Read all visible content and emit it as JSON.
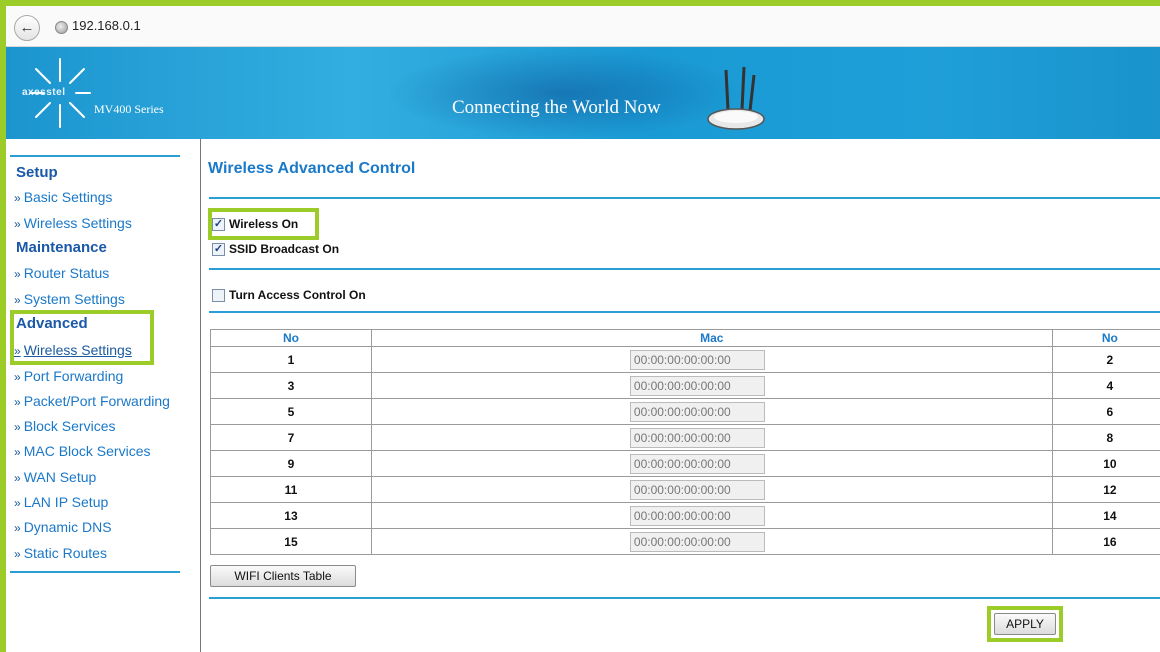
{
  "browser": {
    "back_icon": "back-arrow-icon",
    "url": "192.168.0.1"
  },
  "banner": {
    "brand": "axesstel",
    "series": "MV400 Series",
    "tagline": "Connecting the World Now"
  },
  "sidebar": {
    "sections": [
      {
        "heading": "Setup",
        "items": [
          "Basic Settings",
          "Wireless Settings"
        ]
      },
      {
        "heading": "Maintenance",
        "items": [
          "Router Status",
          "System Settings"
        ]
      },
      {
        "heading": "Advanced",
        "items": [
          "Wireless Settings",
          "Port Forwarding",
          "Packet/Port Forwarding",
          "Block Services",
          "MAC Block Services",
          "WAN Setup",
          "LAN IP Setup",
          "Dynamic DNS",
          "Static Routes"
        ]
      }
    ],
    "arrow": "»"
  },
  "main": {
    "title": "Wireless Advanced Control",
    "wireless_on": {
      "label": "Wireless On",
      "checked": true
    },
    "ssid_broadcast": {
      "label": "SSID Broadcast On",
      "checked": true
    },
    "access_control": {
      "label": "Turn Access Control On",
      "checked": false
    },
    "table": {
      "headers": [
        "No",
        "Mac",
        "No"
      ],
      "rows": [
        {
          "no_left": "1",
          "mac": "00:00:00:00:00:00",
          "no_right": "2"
        },
        {
          "no_left": "3",
          "mac": "00:00:00:00:00:00",
          "no_right": "4"
        },
        {
          "no_left": "5",
          "mac": "00:00:00:00:00:00",
          "no_right": "6"
        },
        {
          "no_left": "7",
          "mac": "00:00:00:00:00:00",
          "no_right": "8"
        },
        {
          "no_left": "9",
          "mac": "00:00:00:00:00:00",
          "no_right": "10"
        },
        {
          "no_left": "11",
          "mac": "00:00:00:00:00:00",
          "no_right": "12"
        },
        {
          "no_left": "13",
          "mac": "00:00:00:00:00:00",
          "no_right": "14"
        },
        {
          "no_left": "15",
          "mac": "00:00:00:00:00:00",
          "no_right": "16"
        }
      ]
    },
    "wifi_clients_button": "WIFI Clients Table",
    "apply_button": "APPLY"
  },
  "colors": {
    "highlight": "#9ccc28",
    "accent": "#1a7ac8",
    "banner": "#1f9fd8"
  }
}
